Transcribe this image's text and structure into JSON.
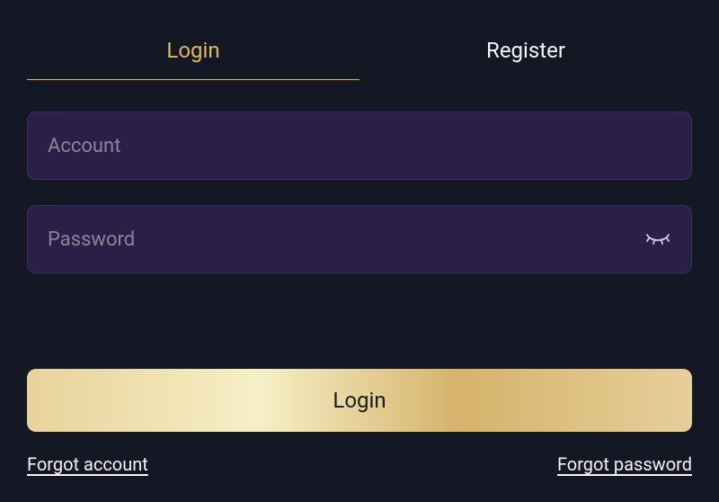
{
  "tabs": {
    "login": "Login",
    "register": "Register",
    "active": "login"
  },
  "inputs": {
    "account": {
      "placeholder": "Account",
      "value": ""
    },
    "password": {
      "placeholder": "Password",
      "value": ""
    }
  },
  "buttons": {
    "login": "Login"
  },
  "links": {
    "forgot_account": "Forgot account",
    "forgot_password": "Forgot password"
  },
  "colors": {
    "accent": "#e5b84a",
    "input_bg": "#2a1f47",
    "page_bg": "#141824"
  }
}
